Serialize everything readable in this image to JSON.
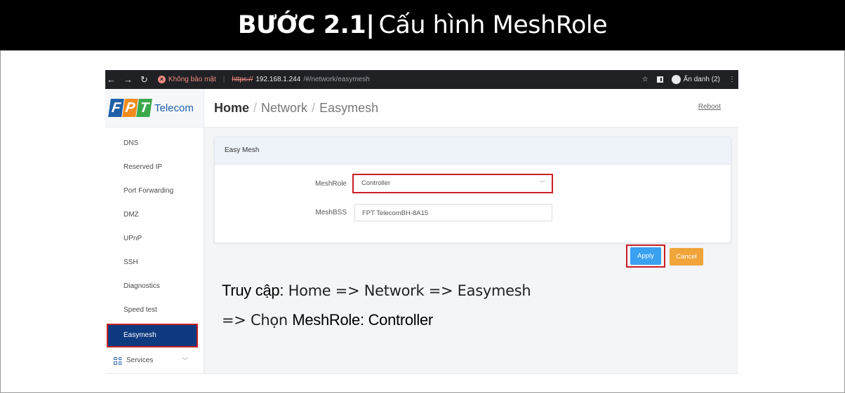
{
  "slide": {
    "title_bold": "BƯỚC 2.1|",
    "title_rest": "Cấu hình MeshRole"
  },
  "browser": {
    "security_warning": "Không bảo mật",
    "url_scheme": "https://",
    "url_host": "192.168.1.244",
    "url_path": "/#/network/easymesh",
    "profile_label": "Ẩn danh (2)"
  },
  "logo": {
    "letters": [
      "F",
      "P",
      "T"
    ],
    "brand": "Telecom"
  },
  "sidebar": {
    "items": [
      {
        "label": "DNS"
      },
      {
        "label": "Reserved IP"
      },
      {
        "label": "Port Forwarding"
      },
      {
        "label": "DMZ"
      },
      {
        "label": "UPnP"
      },
      {
        "label": "SSH"
      },
      {
        "label": "Diagnostics"
      },
      {
        "label": "Speed test"
      },
      {
        "label": "Easymesh"
      },
      {
        "label": "Services"
      }
    ]
  },
  "breadcrumb": {
    "home": "Home",
    "level1": "Network",
    "level2": "Easymesh"
  },
  "topbar": {
    "reboot": "Reboot"
  },
  "card": {
    "title": "Easy Mesh",
    "meshrole_label": "MeshRole",
    "meshrole_value": "Controller",
    "meshbss_label": "MeshBSS",
    "meshbss_value": "FPT TelecomBH-8A15"
  },
  "actions": {
    "apply": "Apply",
    "cancel": "Cancel"
  },
  "instructions": {
    "line1_bold": "Truy cập:",
    "line1_rest": "Home => Network => Easymesh",
    "line2_prefix": "=> Chọn",
    "line2_bold": "MeshRole: Controller"
  },
  "colors": {
    "active_nav": "#0e3b80",
    "highlight": "#c81f23",
    "apply": "#3aa0f0",
    "cancel": "#f0a43a"
  }
}
